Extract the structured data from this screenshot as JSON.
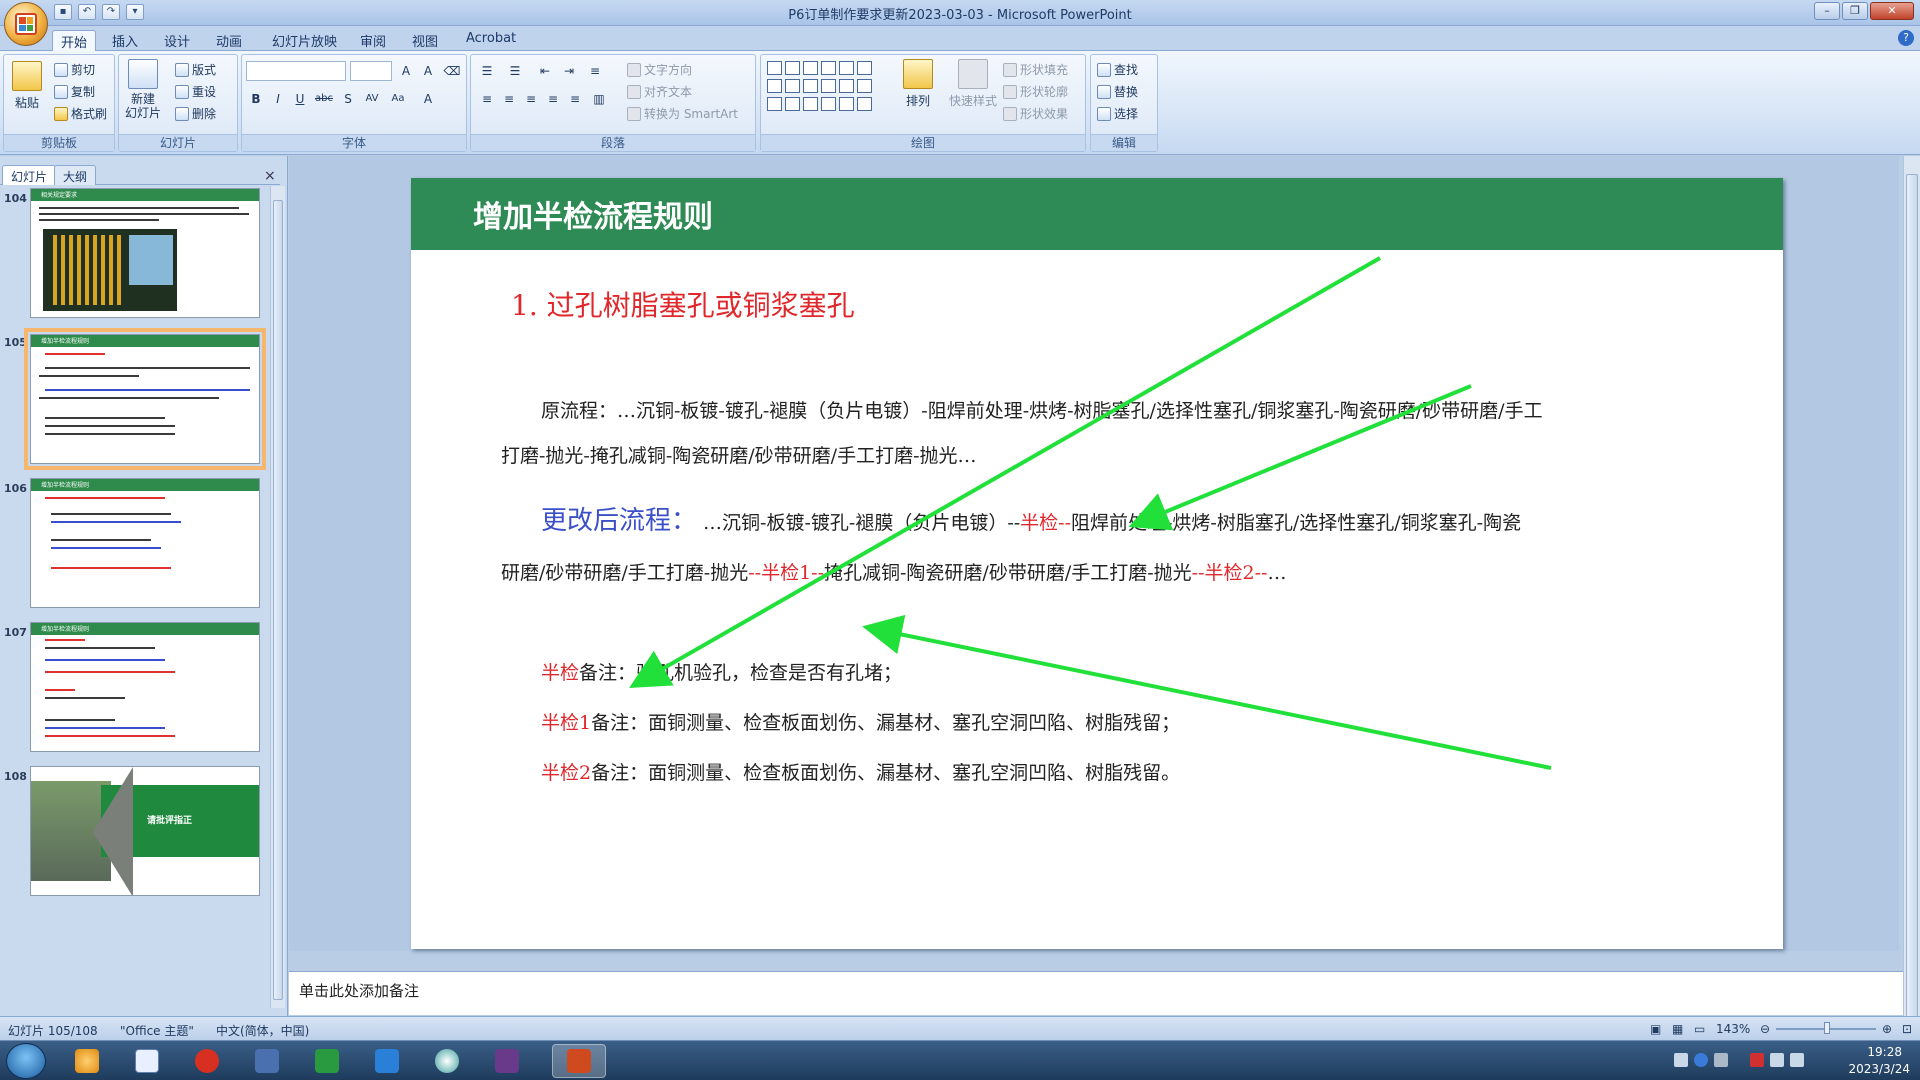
{
  "window": {
    "title": "P6订单制作要求更新2023-03-03 - Microsoft PowerPoint"
  },
  "ribbon": {
    "tabs": [
      "开始",
      "插入",
      "设计",
      "动画",
      "幻灯片放映",
      "审阅",
      "视图",
      "Acrobat"
    ],
    "clipboard": {
      "paste": "粘贴",
      "cut": "剪切",
      "copy": "复制",
      "format_painter": "格式刷",
      "label": "剪贴板"
    },
    "slides": {
      "new_slide": "新建\n幻灯片",
      "layout": "版式",
      "reset": "重设",
      "delete": "删除",
      "label": "幻灯片"
    },
    "font": {
      "label": "字体"
    },
    "paragraph": {
      "text_direction": "文字方向",
      "align_text": "对齐文本",
      "smartart": "转换为 SmartArt",
      "label": "段落"
    },
    "drawing": {
      "arrange": "排列",
      "quick_styles": "快速样式",
      "shape_fill": "形状填充",
      "shape_outline": "形状轮廓",
      "shape_effects": "形状效果",
      "label": "绘图"
    },
    "editing": {
      "find": "查找",
      "replace": "替换",
      "select": "选择",
      "label": "编辑"
    }
  },
  "left_pane": {
    "tabs": [
      "幻灯片",
      "大纲"
    ],
    "close": "×",
    "thumbnails": [
      {
        "num": "104",
        "title": "相关规定要求"
      },
      {
        "num": "105",
        "title": "增加半检流程规则"
      },
      {
        "num": "106",
        "title": "增加半检流程规则"
      },
      {
        "num": "107",
        "title": "增加半检流程规则"
      },
      {
        "num": "108",
        "title": "请批评指正"
      }
    ]
  },
  "slide": {
    "title": "增加半检流程规则",
    "heading": "1.  过孔树脂塞孔或铜浆塞孔",
    "original_label": "原流程：",
    "original_line1": "…沉铜-板镀-镀孔-褪膜（负片电镀）-阻焊前处理-烘烤-树脂塞孔/选择性塞孔/铜浆塞孔-陶瓷研磨/砂带研磨/手工",
    "original_line2": "打磨-抛光-掩孔减铜-陶瓷研磨/砂带研磨/手工打磨-抛光…",
    "modified_label": "更改后流程：",
    "modified_line1_a": " …沉铜-板镀-镀孔-褪膜（负片电镀）--",
    "modified_line1_red": "半检--",
    "modified_line1_b": "阻焊前处理-烘烤-树脂塞孔/选择性塞孔/铜浆塞孔-陶瓷",
    "modified_line2_a": "研磨/砂带研磨/手工打磨-抛光",
    "modified_line2_red1": "--半检1--",
    "modified_line2_b": "掩孔减铜-陶瓷研磨/砂带研磨/手工打磨-抛光",
    "modified_line2_red2": "--半检2--",
    "modified_line2_c": "…",
    "note1_red": "半检",
    "note1": "备注：验孔机验孔，检查是否有孔堵；",
    "note2_red": "半检1",
    "note2": "备注：面铜测量、检查板面划伤、漏基材、塞孔空洞凹陷、树脂残留；",
    "note3_red": "半检2",
    "note3": "备注：面铜测量、检查板面划伤、漏基材、塞孔空洞凹陷、树脂残留。"
  },
  "notes": {
    "placeholder": "单击此处添加备注"
  },
  "status": {
    "slide": "幻灯片 105/108",
    "theme": "\"Office 主题\"",
    "lang": "中文(简体，中国)",
    "zoom": "143%"
  },
  "taskbar": {
    "time": "19:28",
    "date": "2023/3/24"
  },
  "colors": {
    "title_green": "#2f8b55",
    "accent_red": "#e0282c",
    "accent_blue": "#3a4fc8",
    "arrow_green": "#22e03a"
  }
}
